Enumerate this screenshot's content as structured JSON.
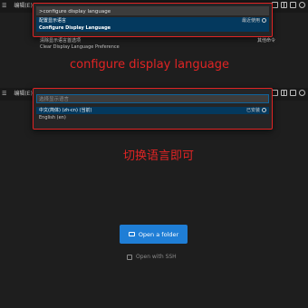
{
  "menu": {
    "left1": "☰",
    "edit": "编辑(E)"
  },
  "palette1": {
    "input_value": ">configure display language",
    "items": [
      {
        "label": "配置显示语言",
        "sublabel": "Configure Display Language",
        "right": "最近使用"
      }
    ]
  },
  "outside_items": {
    "row1_label": "清除显示语言首选项",
    "row1_right": "其他命令",
    "row2_label": "Clear Display Language Preference"
  },
  "annotations": {
    "top": "configure display language",
    "bottom": "切换语言即可"
  },
  "palette2": {
    "placeholder": "选择显示语言",
    "items": [
      {
        "label": "中文(简体) (zh-cn) (当前)",
        "right": "已安装"
      },
      {
        "label": "English (en)"
      }
    ]
  },
  "welcome": {
    "open_folder": "Open a folder",
    "open_ssh": "Open with SSH"
  },
  "colors": {
    "accent_red": "#e02424",
    "button_blue": "#1f7ed6",
    "selection": "#04395e"
  }
}
